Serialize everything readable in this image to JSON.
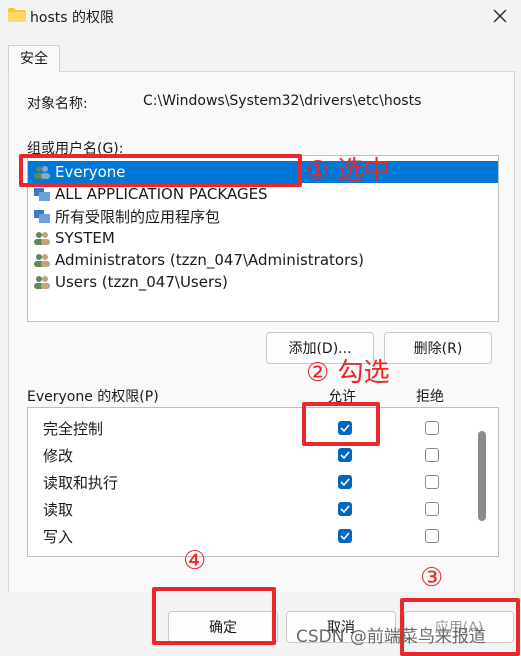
{
  "window": {
    "title": "hosts 的权限",
    "close_icon": "close-icon"
  },
  "tabs": [
    {
      "label": "安全"
    }
  ],
  "object": {
    "label": "对象名称:",
    "value": "C:\\Windows\\System32\\drivers\\etc\\hosts"
  },
  "groups": {
    "label": "组或用户名(G):",
    "items": [
      {
        "label": "Everyone",
        "icon": "users-icon",
        "selected": true
      },
      {
        "label": "ALL APPLICATION PACKAGES",
        "icon": "packages-icon"
      },
      {
        "label": "所有受限制的应用程序包",
        "icon": "packages-icon"
      },
      {
        "label": "SYSTEM",
        "icon": "users-icon"
      },
      {
        "label": "Administrators (tzzn_047\\Administrators)",
        "icon": "users-icon"
      },
      {
        "label": "Users (tzzn_047\\Users)",
        "icon": "users-icon"
      }
    ],
    "add_button": "添加(D)...",
    "remove_button": "删除(R)"
  },
  "permissions": {
    "label": "Everyone 的权限(P)",
    "allow_header": "允许",
    "deny_header": "拒绝",
    "rows": [
      {
        "name": "完全控制",
        "allow": true,
        "deny": false
      },
      {
        "name": "修改",
        "allow": true,
        "deny": false
      },
      {
        "name": "读取和执行",
        "allow": true,
        "deny": false
      },
      {
        "name": "读取",
        "allow": true,
        "deny": false
      },
      {
        "name": "写入",
        "allow": true,
        "deny": false
      }
    ]
  },
  "buttons": {
    "ok": "确定",
    "cancel": "取消",
    "apply": "应用(A)"
  },
  "annotations": {
    "step1": "① 选中",
    "step2": "② 勾选",
    "step3": "③",
    "step4": "④",
    "color": "#e8282b"
  },
  "watermark": "CSDN @前端菜鸟来报道"
}
